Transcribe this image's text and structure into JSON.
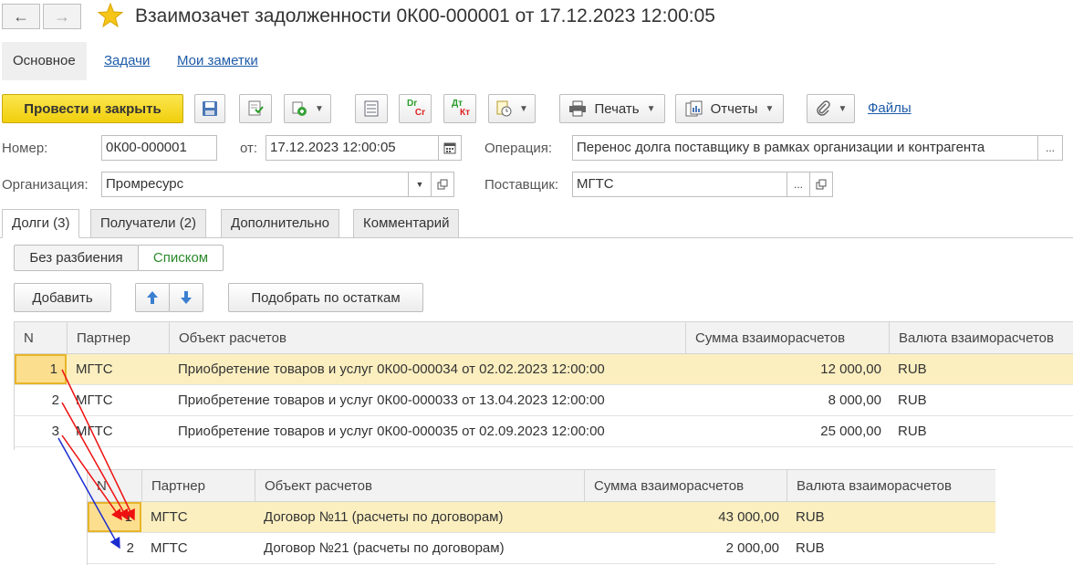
{
  "window": {
    "title": "Взаимозачет задолженности 0К00-000001 от 17.12.2023 12:00:05"
  },
  "section_tabs": [
    "Основное",
    "Задачи",
    "Мои заметки"
  ],
  "toolbar": {
    "post_close": "Провести и закрыть",
    "print": "Печать",
    "reports": "Отчеты",
    "files": "Файлы",
    "dt_kt_en": "Dr",
    "dt_kt_en2": "Cr",
    "dt_kt_ru": "Дт",
    "dt_kt_ru2": "Кт"
  },
  "form": {
    "number_label": "Номер:",
    "number_value": "0К00-000001",
    "date_label": "от:",
    "date_value": "17.12.2023 12:00:05",
    "operation_label": "Операция:",
    "operation_value": "Перенос долга поставщику в рамках организации и контрагента",
    "org_label": "Организация:",
    "org_value": "Промресурс",
    "supplier_label": "Поставщик:",
    "supplier_value": "МГТС"
  },
  "tabs": [
    "Долги (3)",
    "Получатели (2)",
    "Дополнительно",
    "Комментарий"
  ],
  "view_toggle": [
    "Без разбиения",
    "Списком"
  ],
  "actions": {
    "add": "Добавить",
    "pick": "Подобрать по остаткам"
  },
  "debts_table": {
    "columns": [
      "N",
      "Партнер",
      "Объект расчетов",
      "Сумма взаиморасчетов",
      "Валюта взаиморасчетов"
    ],
    "rows": [
      {
        "n": "1",
        "partner": "МГТС",
        "object": "Приобретение товаров и услуг 0К00-000034 от 02.02.2023 12:00:00",
        "sum": "12 000,00",
        "currency": "RUB"
      },
      {
        "n": "2",
        "partner": "МГТС",
        "object": "Приобретение товаров и услуг 0К00-000033 от 13.04.2023 12:00:00",
        "sum": "8 000,00",
        "currency": "RUB"
      },
      {
        "n": "3",
        "partner": "МГТС",
        "object": "Приобретение товаров и услуг 0К00-000035 от 02.09.2023 12:00:00",
        "sum": "25 000,00",
        "currency": "RUB"
      }
    ]
  },
  "recipients_table": {
    "columns": [
      "N",
      "Партнер",
      "Объект расчетов",
      "Сумма взаиморасчетов",
      "Валюта взаиморасчетов"
    ],
    "rows": [
      {
        "n": "1",
        "partner": "МГТС",
        "object": "Договор №11 (расчеты по договорам)",
        "sum": "43 000,00",
        "currency": "RUB"
      },
      {
        "n": "2",
        "partner": "МГТС",
        "object": "Договор №21 (расчеты по договорам)",
        "sum": "2 000,00",
        "currency": "RUB"
      }
    ]
  },
  "colors": {
    "accent_yellow": "#f4d41f",
    "link_blue": "#1e5ba8",
    "arrow_red": "#ee1111",
    "arrow_blue": "#1a2bd0",
    "selected_row": "#fbefc0"
  }
}
